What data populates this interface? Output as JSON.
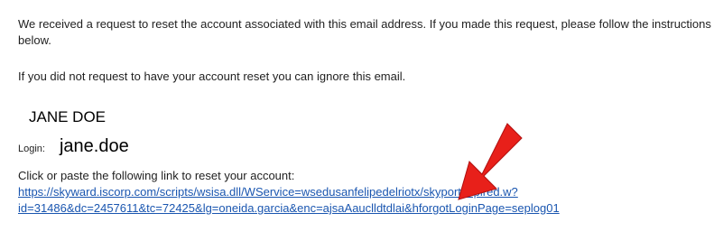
{
  "email": {
    "intro": "We received a request to reset the account associated with this email address.  If you made this request, please follow the instructions below.",
    "ignore_note": "If you did not request to have your account reset you can ignore this email.",
    "name": "JANE DOE",
    "login_label": "Login:",
    "login_value": "jane.doe",
    "instruction": "Click or paste the following link to reset your account:",
    "link_line1": "https://skyward.iscorp.com/scripts/wsisa.dll/WService=wsedusanfelipedelriotx/skyportexpired.w?",
    "link_line2": "id=31486&dc=2457611&tc=72425&lg=oneida.garcia&enc=ajsaAauclldtdlai&hforgotLoginPage=seplog01"
  },
  "colors": {
    "link": "#1a56b0",
    "arrow": "#e8201a"
  },
  "icons": {
    "annotation": "red-arrow-icon"
  }
}
